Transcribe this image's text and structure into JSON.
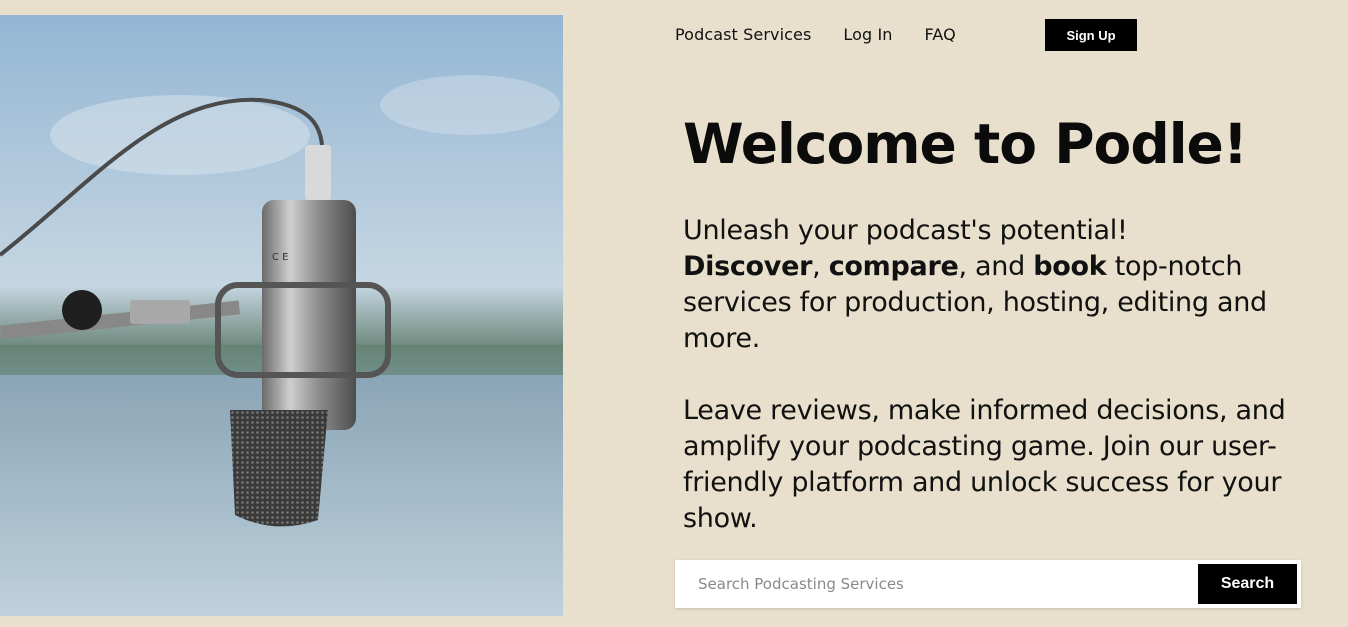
{
  "nav": {
    "items": [
      {
        "label": "Podcast Services"
      },
      {
        "label": "Log In"
      },
      {
        "label": "FAQ"
      }
    ],
    "signup_label": "Sign Up"
  },
  "hero": {
    "title": "Welcome to Podle!",
    "p1": {
      "line1": "Unleash your podcast's potential!",
      "discover": "Discover",
      "sep1": ", ",
      "compare": "compare",
      "sep2": ", and ",
      "book": "book",
      "rest": " top-notch services for production, hosting, editing and more."
    },
    "p2": "Leave reviews, make informed decisions, and amplify your podcasting game. Join our user-friendly platform and unlock success for your show."
  },
  "search": {
    "placeholder": "Search Podcasting Services",
    "value": "",
    "button_label": "Search"
  },
  "colors": {
    "background": "#e8dfcc",
    "button": "#000000",
    "text": "#0d0d0d"
  }
}
